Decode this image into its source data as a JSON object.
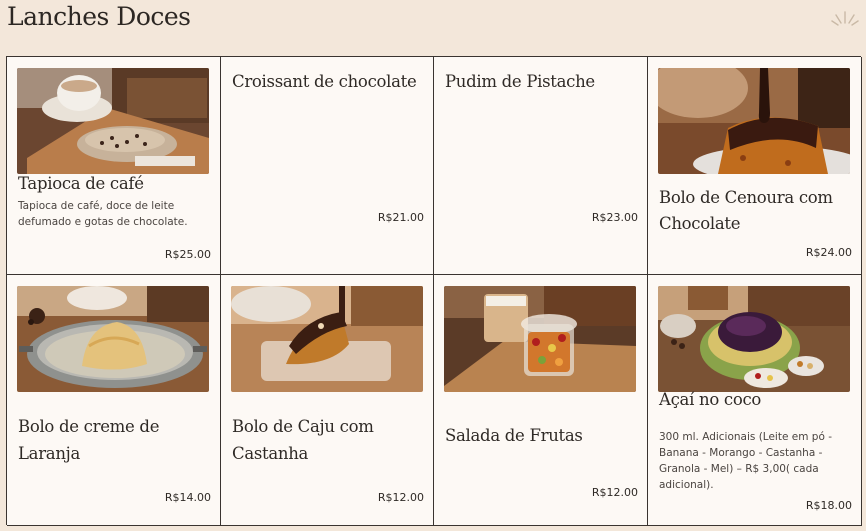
{
  "section": {
    "title": "Lanches Doces"
  },
  "products": [
    {
      "name": "Tapioca de café",
      "description": "Tapioca de café, doce de leite defumado e gotas de chocolate.",
      "price": "R$25.00",
      "image": "tapioca-photo"
    },
    {
      "name": "Croissant de chocolate",
      "description": "",
      "price": "R$21.00",
      "image": ""
    },
    {
      "name": "Pudim de Pistache",
      "description": "",
      "price": "R$23.00",
      "image": ""
    },
    {
      "name": "Bolo de Cenoura com Chocolate",
      "description": "",
      "price": "R$24.00",
      "image": "carrot-cake-photo"
    },
    {
      "name": "Bolo de creme de Laranja",
      "description": "",
      "price": "R$14.00",
      "image": "orange-cake-photo"
    },
    {
      "name": "Bolo de Caju com Castanha",
      "description": "",
      "price": "R$12.00",
      "image": "cashew-cake-photo"
    },
    {
      "name": "Salada de Frutas",
      "description": "",
      "price": "R$12.00",
      "image": "fruit-salad-photo"
    },
    {
      "name": "Açaí no coco",
      "description": "300 ml. Adicionais (Leite em pó - Banana - Morango - Castanha - Granola - Mel) – R$ 3,00( cada adicional).",
      "price": "R$18.00",
      "image": "acai-photo"
    }
  ],
  "colors": {
    "background": "#f3e7da",
    "card": "#fdf9f5",
    "border": "#3a3430",
    "text": "#2f2a26"
  }
}
